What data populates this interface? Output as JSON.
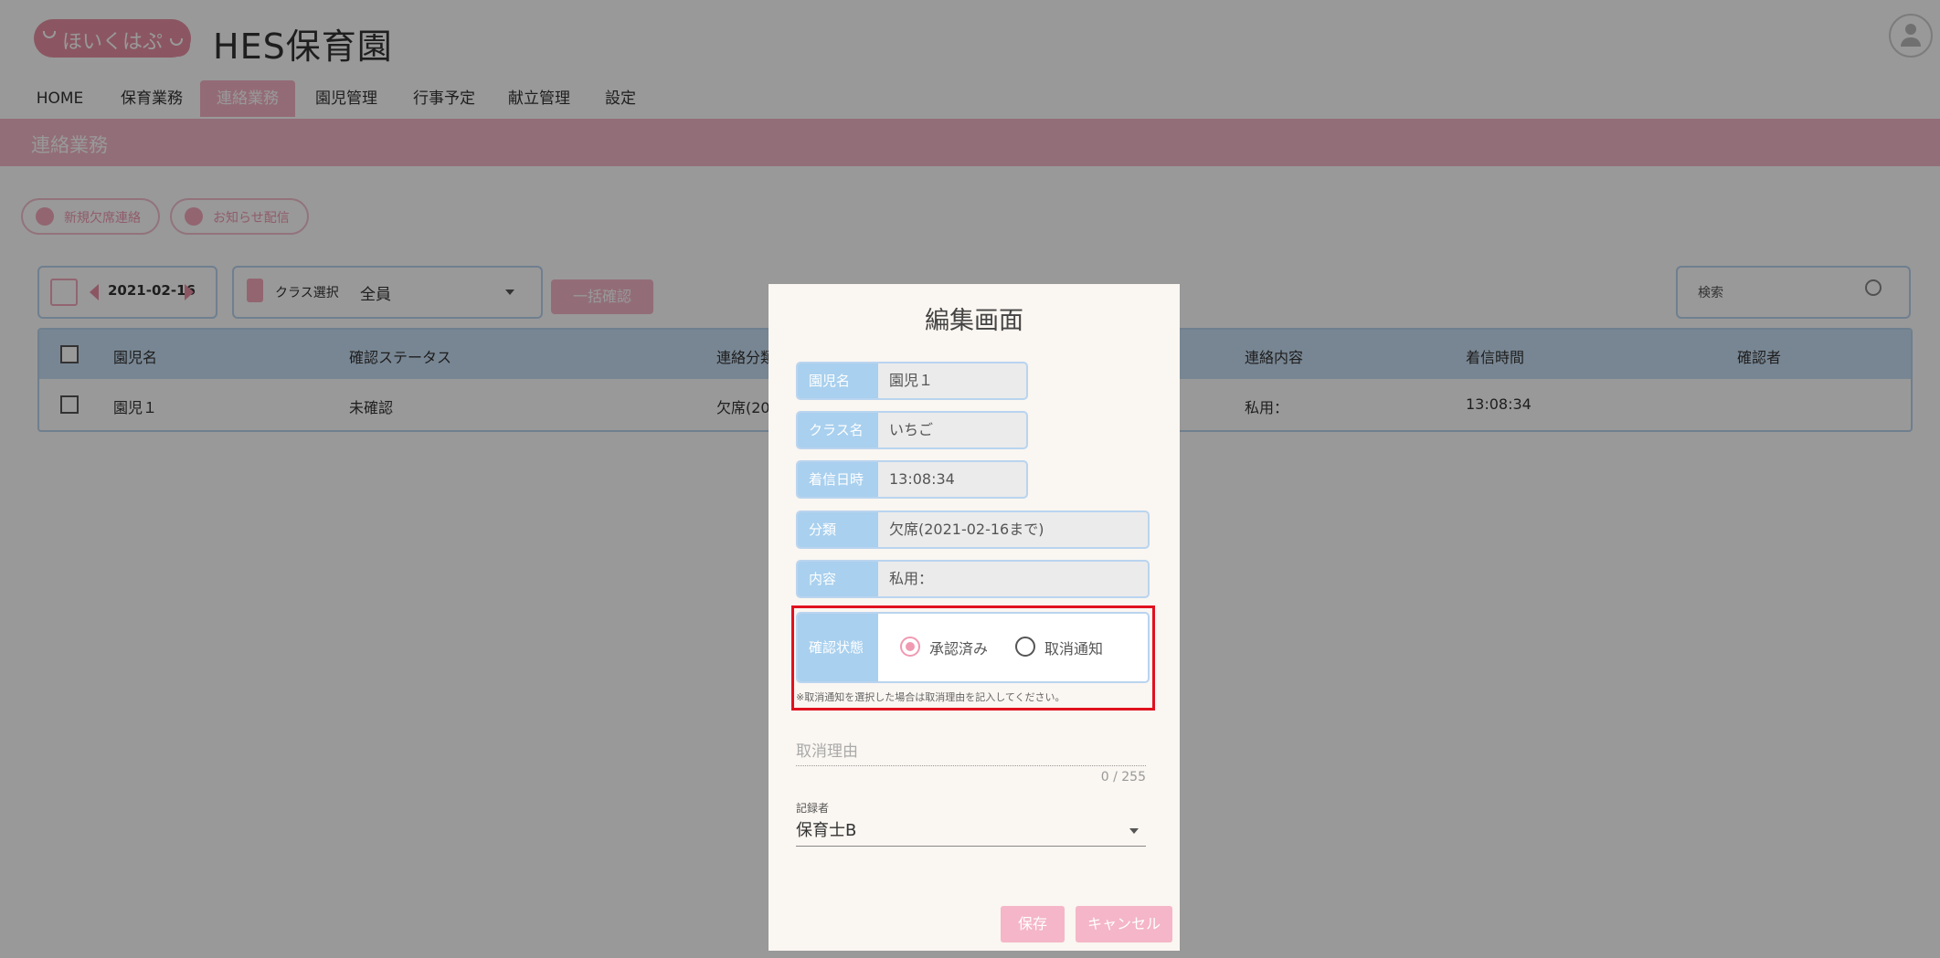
{
  "header": {
    "logo_text": "ほいくはぷ",
    "title": "HES保育園"
  },
  "nav": {
    "items": [
      {
        "label": "HOME"
      },
      {
        "label": "保育業務"
      },
      {
        "label": "連絡業務",
        "active": true
      },
      {
        "label": "園児管理"
      },
      {
        "label": "行事予定"
      },
      {
        "label": "献立管理"
      },
      {
        "label": "設定"
      }
    ]
  },
  "page": {
    "title": "連絡業務",
    "actions": {
      "new_absence": "新規欠席連絡",
      "notice": "お知らせ配信"
    }
  },
  "filters": {
    "date": "2021-02-16",
    "class_label": "クラス選択",
    "class_value": "全員",
    "bulk_confirm": "一括確認",
    "search_placeholder": "検索"
  },
  "table": {
    "headers": [
      "園児名",
      "確認ステータス",
      "連絡分類",
      "連絡内容",
      "着信時間",
      "確認者"
    ],
    "rows": [
      {
        "name": "園児１",
        "status": "未確認",
        "category": "欠席(20",
        "content": "私用：",
        "time": "13:08:34",
        "confirmer": ""
      }
    ]
  },
  "dialog": {
    "title": "編集画面",
    "fields": {
      "child_label": "園児名",
      "child_value": "園児１",
      "class_label": "クラス名",
      "class_value": "いちご",
      "time_label": "着信日時",
      "time_value": "13:08:34",
      "category_label": "分類",
      "category_value": "欠席(2021-02-16まで)",
      "content_label": "内容",
      "content_value": "私用："
    },
    "status": {
      "label": "確認状態",
      "options": [
        {
          "label": "承認済み",
          "selected": true
        },
        {
          "label": "取消通知",
          "selected": false
        }
      ],
      "note": "※取消通知を選択した場合は取消理由を記入してください。"
    },
    "reason": {
      "placeholder": "取消理由",
      "counter": "0 / 255"
    },
    "recorder": {
      "label": "記録者",
      "value": "保育士B"
    },
    "buttons": {
      "save": "保存",
      "cancel": "キャンセル"
    }
  },
  "colors": {
    "accent_pink": "#f4b7c8",
    "label_blue": "#a9d0ee",
    "highlight_red": "#e0121f"
  }
}
